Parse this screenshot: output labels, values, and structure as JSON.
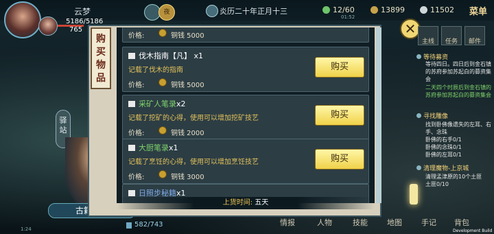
{
  "player": {
    "name": "云梦",
    "hp": "5186/5186",
    "mp": "765"
  },
  "header": {
    "date": "炎历二十年正月十三",
    "time": "01:52",
    "energy": "12/60",
    "copper": "13899",
    "silver": "11502",
    "menu_label": "菜单",
    "yin_label": "夜"
  },
  "left": {
    "station_label": "驿站",
    "npc_name": "古籍商人",
    "ping": "1:24",
    "bag_count": "582/743"
  },
  "shop": {
    "title": "购买物品",
    "price_label": "价格:",
    "buy_label": "购买",
    "top_item_price": "铜钱 5000",
    "items": [
      {
        "name": "伐木指南【凡】",
        "qty": "x1",
        "desc": "记载了伐木的指南",
        "price": "铜钱 5000"
      },
      {
        "name": "采矿人笔录",
        "qty": "x2",
        "desc": "记载了挖矿的心得，使用可以增加挖矿技艺",
        "price": "铜钱 2000"
      },
      {
        "name": "大厨笔录",
        "qty": "x1",
        "desc": "记载了烹饪的心得，使用可以增加烹饪技艺",
        "price": "铜钱 3000"
      },
      {
        "name": "日照步秘籍",
        "qty": "x1"
      }
    ],
    "restock_label": "上货时间:",
    "restock_value": "五天"
  },
  "quest_tabs": [
    "主线",
    "任务",
    "邮件"
  ],
  "quests": [
    {
      "title": "等待募资",
      "text": "等待四日。四日后到金石镇的苏府参加苏起白的募资集会",
      "text2": "二天四个时辰后到金石镇的苏府参加苏起白的募资集会"
    },
    {
      "title": "寻找雕像",
      "text": "找到卧佛像遗失的左耳、右手、念珠",
      "lines": [
        "卧佛的右手0/1",
        "卧佛的念珠0/1",
        "卧佛的左耳0/1"
      ]
    },
    {
      "title": "清理魔物-上京城",
      "text": "清理孟津原的10个土匪",
      "text2": "土匪0/10"
    }
  ],
  "bottom_nav": [
    "情报",
    "人物",
    "技能",
    "地图",
    "手记",
    "背包"
  ],
  "dev_build": "Development Build"
}
